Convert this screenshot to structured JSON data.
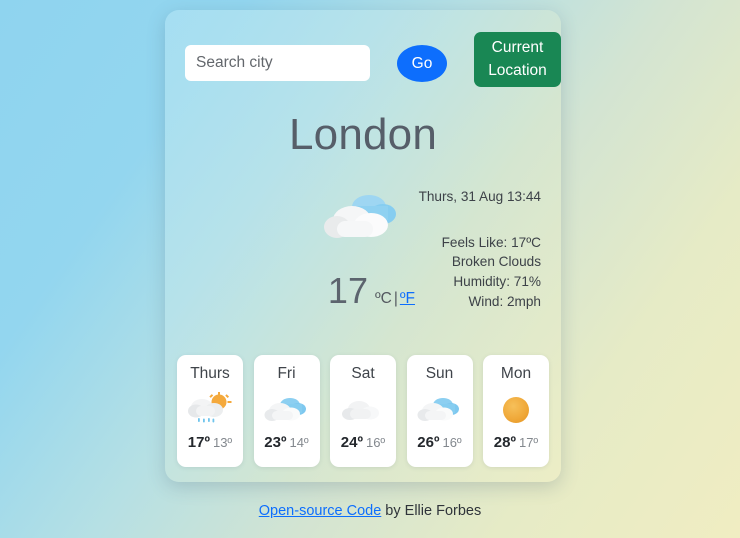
{
  "search": {
    "placeholder": "Search city",
    "value": "",
    "go_label": "Go",
    "current_location_label": "Current Location"
  },
  "current": {
    "city": "London",
    "datetime": "Thurs, 31 Aug 13:44",
    "icon": "broken-clouds-icon",
    "temperature": "17",
    "unit_active": "ºC",
    "unit_separator": "|",
    "unit_link": "ºF",
    "feels_like": "Feels Like: 17ºC",
    "description": "Broken Clouds",
    "humidity": "Humidity: 71%",
    "wind": "Wind: 2mph"
  },
  "forecast": [
    {
      "day": "Thurs",
      "icon": "sun-cloud-rain-icon",
      "max": "17º",
      "min": "13º"
    },
    {
      "day": "Fri",
      "icon": "broken-clouds-icon",
      "max": "23º",
      "min": "14º"
    },
    {
      "day": "Sat",
      "icon": "cloud-icon",
      "max": "24º",
      "min": "16º"
    },
    {
      "day": "Sun",
      "icon": "broken-clouds-icon",
      "max": "26º",
      "min": "16º"
    },
    {
      "day": "Mon",
      "icon": "sun-icon",
      "max": "28º",
      "min": "17º"
    }
  ],
  "footer": {
    "link_label": "Open-source Code",
    "credit": " by Ellie Forbes"
  },
  "colors": {
    "go_button": "#0d6efd",
    "location_button": "#198754",
    "link": "#0d6efd",
    "sun": "#f0a830",
    "cloud_blue": "#7ec8ef",
    "heading": "#565e69"
  }
}
